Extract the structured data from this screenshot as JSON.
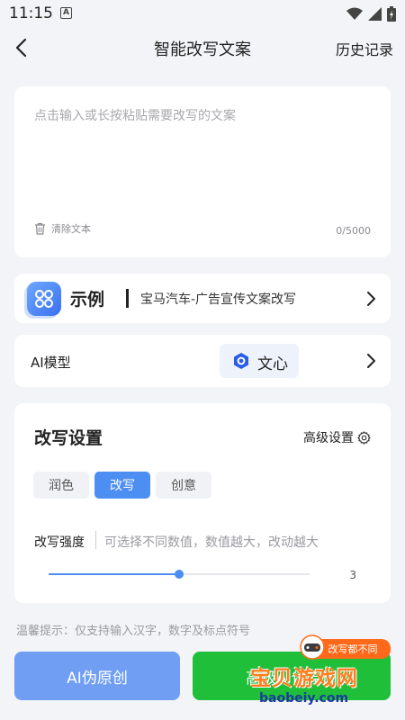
{
  "status_bar": {
    "time": "11:15",
    "notification_glyph": "A"
  },
  "header": {
    "title": "智能改写文案",
    "history_label": "历史记录"
  },
  "input": {
    "placeholder": "点击输入或长按粘贴需要改写的文案",
    "clear_label": "清除文本",
    "char_count": "0/5000"
  },
  "example": {
    "title": "示例",
    "name": "宝马汽车-广告宣传文案改写"
  },
  "model": {
    "label": "AI模型",
    "value": "文心"
  },
  "settings": {
    "title": "改写设置",
    "advanced_label": "高级设置",
    "modes": [
      {
        "label": "润色",
        "active": false
      },
      {
        "label": "改写",
        "active": true
      },
      {
        "label": "创意",
        "active": false
      }
    ],
    "strength_label": "改写强度",
    "strength_hint": "可选择不同数值，数值越大，改动越大",
    "strength_value": "3",
    "strength_fraction": 0.5
  },
  "tip": "温馨提示：仅支持输入汉字，数字及标点符号",
  "buttons": {
    "primary": "AI伪原创",
    "advanced": "高级AI伪原创",
    "promo_badge": "改写都不同"
  },
  "watermark": {
    "main": "宝贝游戏网",
    "sub": "baobeiy.com"
  },
  "colors": {
    "accent": "#4d8ef3",
    "primary_button": "#6f9ef3",
    "advanced_button": "#1fbf3a",
    "badge": "#ff6a1a"
  },
  "icons": [
    "back-arrow-icon",
    "trash-icon",
    "example-logo-icon",
    "chevron-right-icon",
    "wenxin-logo-icon",
    "gear-icon",
    "wifi-icon",
    "signal-icon",
    "battery-icon"
  ]
}
